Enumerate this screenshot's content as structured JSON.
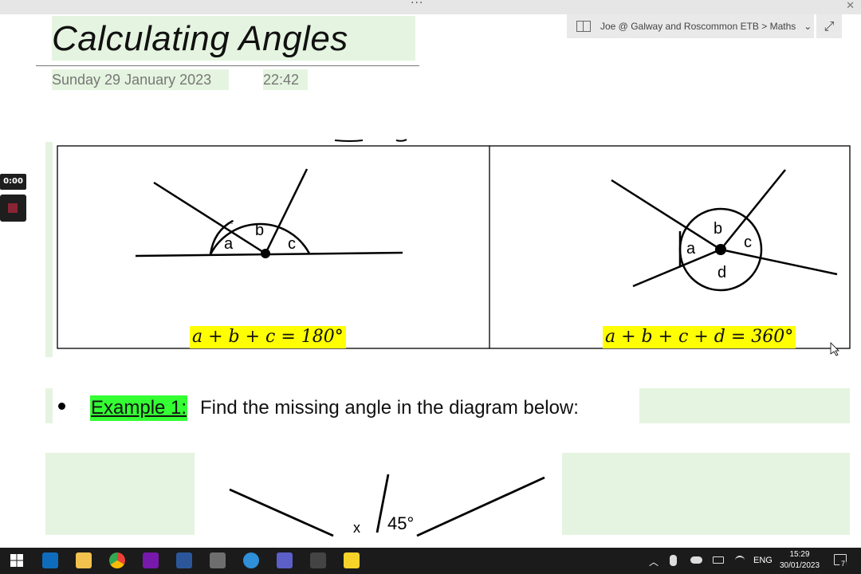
{
  "window": {
    "more_label": "···",
    "close_label": "✕"
  },
  "page": {
    "title": "Calculating Angles",
    "date": "Sunday 29 January 2023",
    "time": "22:42"
  },
  "breadcrumb": {
    "label": "Joe @ Galway and Roscommon ETB > Maths",
    "chevron": "⌄",
    "expand_icon": "⤢"
  },
  "recording": {
    "timer": "0:00"
  },
  "diagrams": {
    "left": {
      "labels": [
        "a",
        "b",
        "c"
      ],
      "formula": "a + b + c = 180°"
    },
    "right": {
      "labels": [
        "a",
        "b",
        "c",
        "d"
      ],
      "formula": "a + b + c + d = 360°"
    }
  },
  "example": {
    "label": "Example 1:",
    "text": "Find the missing angle in the diagram below:",
    "diagram_labels": [
      "x",
      "45°"
    ]
  },
  "taskbar": {
    "apps": [
      "Outlook",
      "File Explorer",
      "Chrome",
      "OneNote",
      "Word",
      "Calculator",
      "Edge",
      "Teams",
      "Phone",
      "Sticky Notes"
    ],
    "language": "ENG",
    "clock_time": "15:29",
    "clock_date": "30/01/2023",
    "notifications": "7"
  },
  "colors": {
    "highlight_green": "#e5f4e0",
    "formula_yellow": "#ffff00",
    "example_green": "#33ff33",
    "taskbar": "#1b1b1b"
  }
}
